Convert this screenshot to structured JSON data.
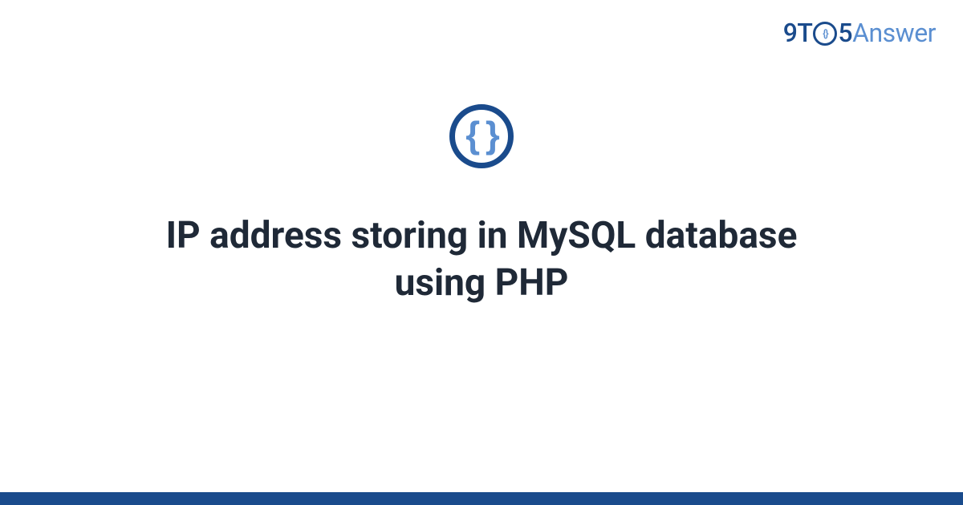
{
  "logo": {
    "part_9t": "9T",
    "part_o_inner": "{}",
    "part_5": "5",
    "part_answer": "Answer"
  },
  "icon": {
    "braces": "{ }"
  },
  "title": "IP address storing in MySQL database using PHP",
  "colors": {
    "brand_dark": "#1a4b8c",
    "brand_light": "#5b8fd1",
    "text": "#1f2937"
  }
}
